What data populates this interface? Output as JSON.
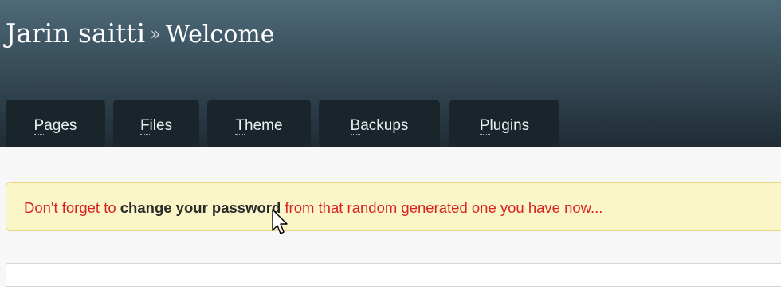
{
  "header": {
    "site_name": "Jarin saitti",
    "separator": "»",
    "page_title": "Welcome"
  },
  "tabs": [
    {
      "first_letter": "P",
      "rest": "ages"
    },
    {
      "first_letter": "F",
      "rest": "iles"
    },
    {
      "first_letter": "T",
      "rest": "heme"
    },
    {
      "first_letter": "B",
      "rest": "ackups"
    },
    {
      "first_letter": "P",
      "rest": "lugins"
    }
  ],
  "notice": {
    "prefix": "Don't forget to ",
    "link": "change your password",
    "suffix": " from that random generated one you have now..."
  },
  "colors": {
    "notice_text": "#d92323",
    "notice_bg": "#fbf6c7",
    "tab_bg": "#19242b"
  },
  "icons": {
    "cursor": "hand-pointer-icon"
  }
}
